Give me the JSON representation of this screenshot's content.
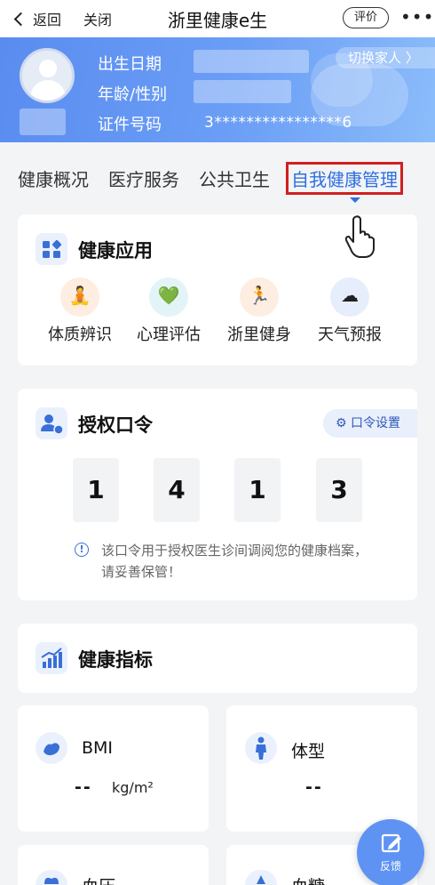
{
  "nav": {
    "back_label": "返回",
    "close_label": "关闭",
    "title": "浙里健康e生",
    "rate_label": "评价",
    "more_label": "•••"
  },
  "profile": {
    "birth_label": "出生日期",
    "age_gender_label": "年龄/性别",
    "id_label": "证件号码",
    "id_value": "3****************6",
    "switch_label": "切换家人 〉"
  },
  "tabs": [
    {
      "label": "健康概况"
    },
    {
      "label": "医疗服务"
    },
    {
      "label": "公共卫生"
    },
    {
      "label": "自我健康管理",
      "active": true
    }
  ],
  "health_apps": {
    "title": "健康应用",
    "items": [
      {
        "label": "体质辨识",
        "icon": "constitution-icon"
      },
      {
        "label": "心理评估",
        "icon": "heart-psych-icon"
      },
      {
        "label": "浙里健身",
        "icon": "treadmill-icon"
      },
      {
        "label": "天气预报",
        "icon": "weather-cloud-icon"
      }
    ]
  },
  "auth_code": {
    "title": "授权口令",
    "settings_label": "口令设置",
    "digits": [
      "1",
      "4",
      "1",
      "3"
    ],
    "notice": "该口令用于授权医生诊间调阅您的健康档案，请妥善保管！"
  },
  "health_metrics": {
    "title": "健康指标",
    "bmi": {
      "label": "BMI",
      "value": "--",
      "unit": "kg/m²"
    },
    "body_type": {
      "label": "体型",
      "value": "--"
    },
    "blood_pressure": {
      "label": "血压"
    },
    "blood_sugar": {
      "label": "血糖"
    }
  },
  "fab": {
    "label": "反馈"
  },
  "colors": {
    "accent": "#2f6fe0",
    "highlight_border": "#d21f1f",
    "profile_bg": "#6b9ef6"
  }
}
